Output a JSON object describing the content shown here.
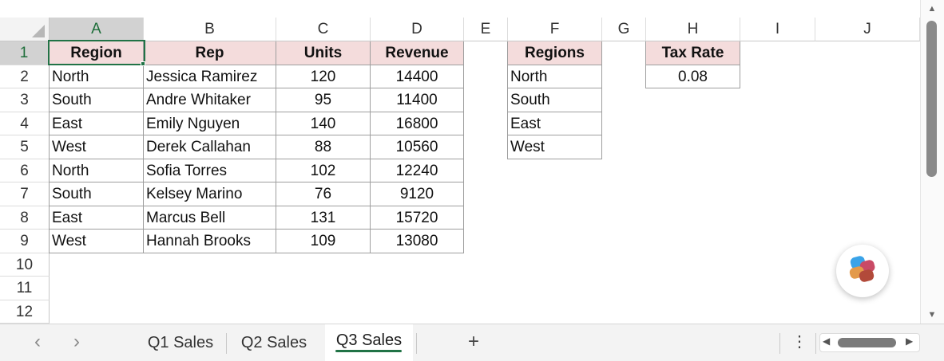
{
  "columns": [
    "A",
    "B",
    "C",
    "D",
    "E",
    "F",
    "G",
    "H",
    "I",
    "J"
  ],
  "rows": [
    "1",
    "2",
    "3",
    "4",
    "5",
    "6",
    "7",
    "8",
    "9",
    "10",
    "11",
    "12"
  ],
  "table": {
    "headers": {
      "region": "Region",
      "rep": "Rep",
      "units": "Units",
      "revenue": "Revenue"
    },
    "rows": [
      {
        "region": "North",
        "rep": "Jessica Ramirez",
        "units": "120",
        "revenue": "14400"
      },
      {
        "region": "South",
        "rep": "Andre Whitaker",
        "units": "95",
        "revenue": "11400"
      },
      {
        "region": "East",
        "rep": "Emily Nguyen",
        "units": "140",
        "revenue": "16800"
      },
      {
        "region": "West",
        "rep": "Derek Callahan",
        "units": "88",
        "revenue": "10560"
      },
      {
        "region": "North",
        "rep": "Sofia Torres",
        "units": "102",
        "revenue": "12240"
      },
      {
        "region": "South",
        "rep": "Kelsey Marino",
        "units": "76",
        "revenue": "9120"
      },
      {
        "region": "East",
        "rep": "Marcus Bell",
        "units": "131",
        "revenue": "15720"
      },
      {
        "region": "West",
        "rep": "Hannah Brooks",
        "units": "109",
        "revenue": "13080"
      }
    ]
  },
  "regions_list": {
    "header": "Regions",
    "items": [
      "North",
      "South",
      "East",
      "West"
    ]
  },
  "tax": {
    "header": "Tax Rate",
    "value": "0.08"
  },
  "sheet_tabs": [
    "Q1 Sales",
    "Q2 Sales",
    "Q3 Sales"
  ],
  "active_tab": "Q3 Sales",
  "tab_bar": {
    "prev": "‹",
    "next": "›",
    "add": "+",
    "more": "⋮"
  },
  "scroll": {
    "up": "▲",
    "down": "▼",
    "left": "◀",
    "right": "▶"
  },
  "colors": {
    "accent": "#217346",
    "header_fill": "#f4dcdc"
  },
  "icons": {
    "copilot": "copilot-icon"
  }
}
